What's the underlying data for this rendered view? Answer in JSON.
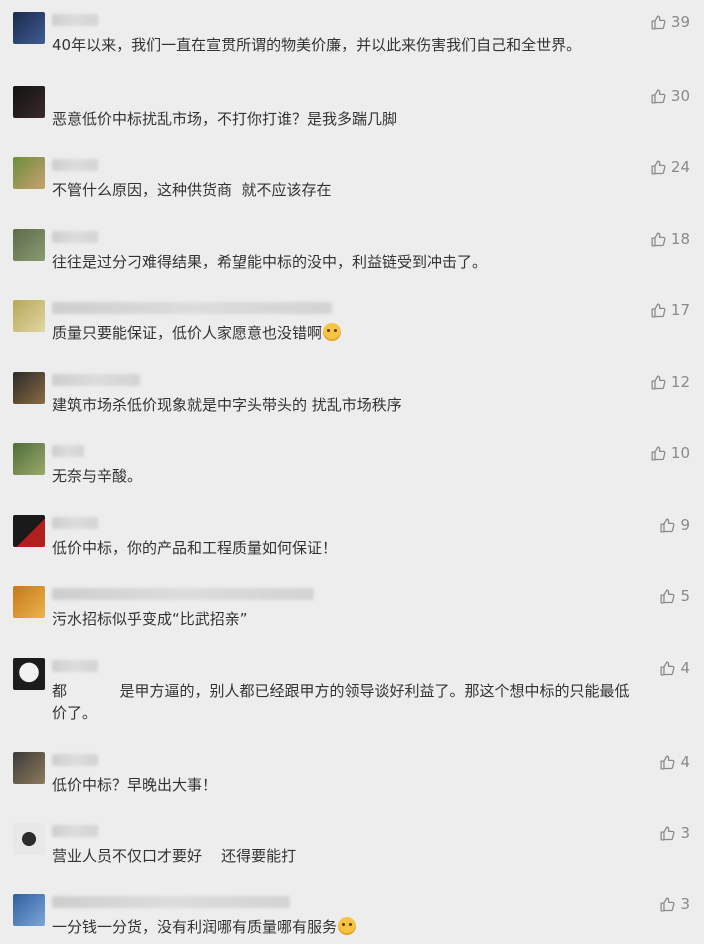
{
  "comments": [
    {
      "text": "40年以来，我们一直在宣贯所谓的物美价廉，并以此来伤害我们自己和全世界。",
      "likes": "39",
      "avatar_colors": [
        "#1b2a4a",
        "#3e5d96"
      ]
    },
    {
      "text": "恶意低价中标扰乱市场，不打你打谁？是我多踹几脚",
      "likes": "30",
      "avatar_colors": [
        "#121212",
        "#3a2a2a"
      ]
    },
    {
      "text": "不管什么原因，这种供货商  就不应该存在",
      "likes": "24",
      "avatar_colors": [
        "#6a8f3a",
        "#c9a070"
      ]
    },
    {
      "text": "往往是过分刁难得结果，希望能中标的没中，利益链受到冲击了。",
      "likes": "18",
      "avatar_colors": [
        "#5d6b4a",
        "#8a9b72"
      ]
    },
    {
      "text": "质量只要能保证，低价人家愿意也没错啊",
      "likes": "17",
      "avatar_colors": [
        "#b7a85a",
        "#e0d7a3"
      ],
      "emoji": "pleading-face"
    },
    {
      "text": "建筑市场杀低价现象就是中字头带头的 扰乱市场秩序",
      "likes": "12",
      "avatar_colors": [
        "#2a2a2a",
        "#8b6b42"
      ]
    },
    {
      "text": "无奈与辛酸。",
      "likes": "10",
      "avatar_colors": [
        "#4f6d3a",
        "#9aa96b"
      ]
    },
    {
      "text": "低价中标，你的产品和工程质量如何保证！",
      "likes": "9",
      "avatar_colors": [
        "#1a1a1a",
        "#b21f1f"
      ]
    },
    {
      "text": "污水招标似乎变成“比武招亲”",
      "likes": "5",
      "avatar_colors": [
        "#c9761c",
        "#e8b64a"
      ]
    },
    {
      "text": "都           是甲方逼的，别人都已经跟甲方的领导谈好利益了。那这个想中标的只能最低价了。",
      "likes": "4",
      "avatar_colors": [
        "#f2f2f2",
        "#1c1c1c"
      ]
    },
    {
      "text": "低价中标？早晚出大事！",
      "likes": "4",
      "avatar_colors": [
        "#3b3b3b",
        "#8c7b5b"
      ]
    },
    {
      "text": "营业人员不仅口才要好    还得要能打",
      "likes": "3",
      "avatar_colors": [
        "#e8e8e8",
        "#2c2c2c"
      ]
    },
    {
      "text": "一分钱一分货，没有利润哪有质量哪有服务",
      "likes": "3",
      "avatar_colors": [
        "#2f5e9e",
        "#7da7d9"
      ],
      "emoji": "tongue-out-face"
    }
  ],
  "icons": {
    "like": "thumbs-up-icon"
  },
  "colors": {
    "background": "#ededed",
    "text": "#333333",
    "meta": "#8a8a8a"
  }
}
